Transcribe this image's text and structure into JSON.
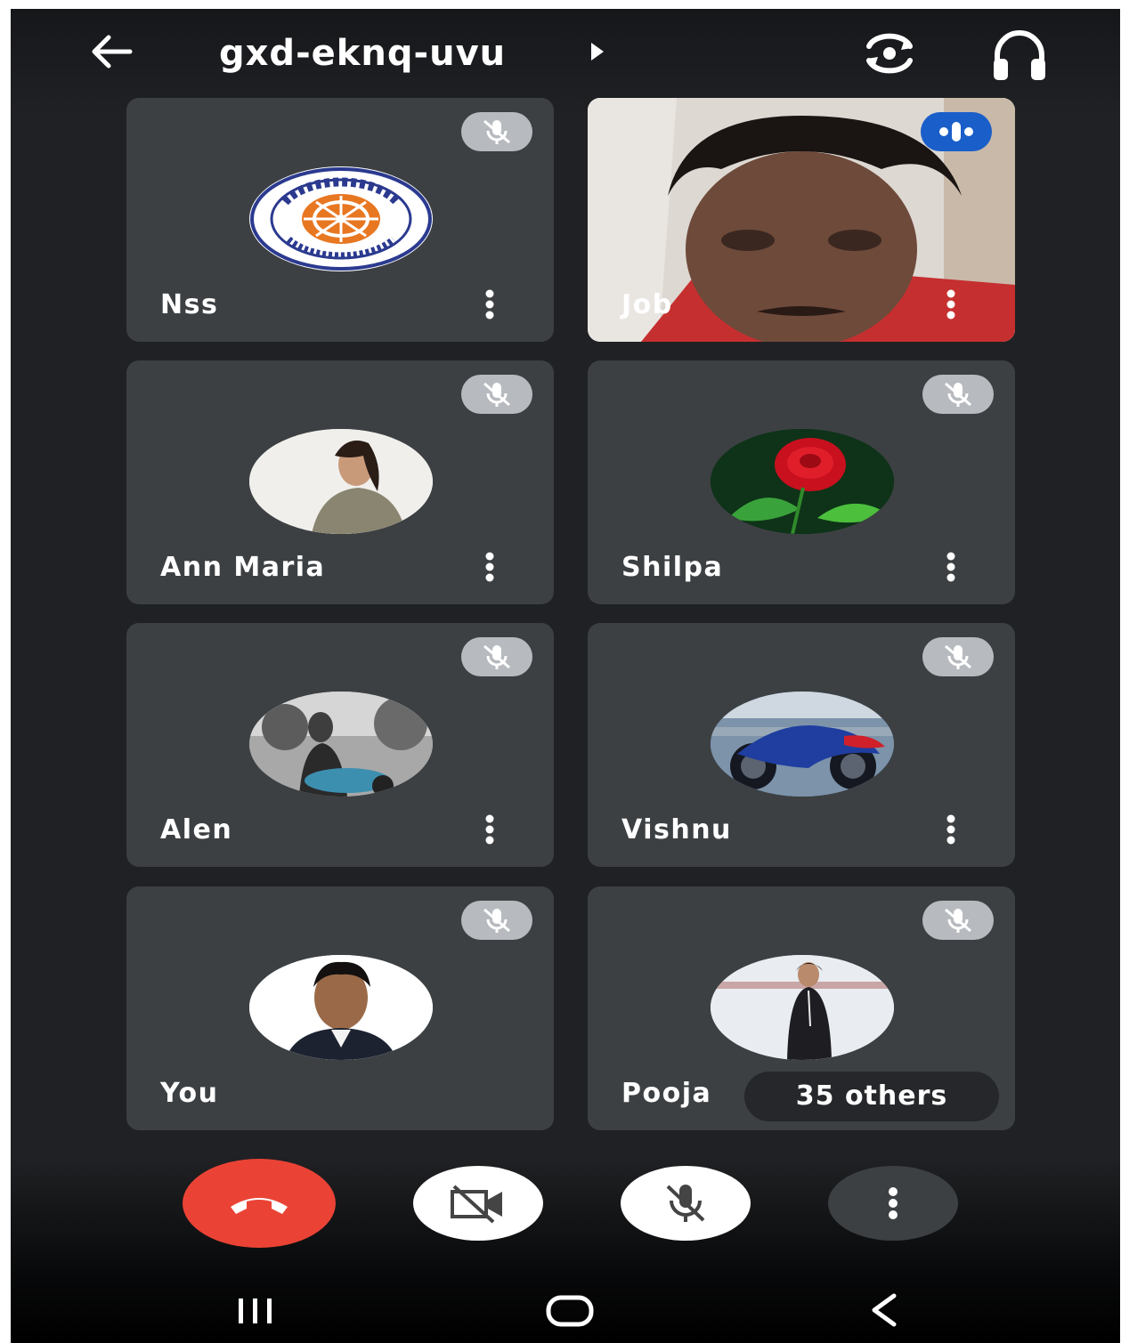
{
  "header": {
    "meeting_code": "gxd-eknq-uvu",
    "icons": [
      "back-arrow-icon",
      "caret-right-icon",
      "switch-camera-icon",
      "headphones-icon"
    ]
  },
  "participants": [
    {
      "name": "Nss",
      "muted": true,
      "avatar": "nss-logo"
    },
    {
      "name": "Job",
      "muted": false,
      "speaking": true,
      "avatar": "live-video"
    },
    {
      "name": "Ann Maria",
      "muted": true,
      "avatar": "photo"
    },
    {
      "name": "Shilpa",
      "muted": true,
      "avatar": "red-rose-photo"
    },
    {
      "name": "Alen",
      "muted": true,
      "avatar": "photo"
    },
    {
      "name": "Vishnu",
      "muted": true,
      "avatar": "motorbike-photo"
    },
    {
      "name": "You",
      "muted": true,
      "avatar": "photo"
    },
    {
      "name": "Pooja",
      "muted": true,
      "avatar": "photo"
    }
  ],
  "others_chip": "35 others",
  "controls": {
    "icons": [
      "end-call-icon",
      "camera-off-icon",
      "mic-off-icon",
      "more-options-icon"
    ],
    "end_call_color": "#ea4335"
  },
  "nav": {
    "icons": [
      "recents-icon",
      "home-icon",
      "back-icon"
    ]
  },
  "colors": {
    "background": "#202124",
    "tile": "#3c4043",
    "speaking_badge": "#1a5ec9"
  }
}
